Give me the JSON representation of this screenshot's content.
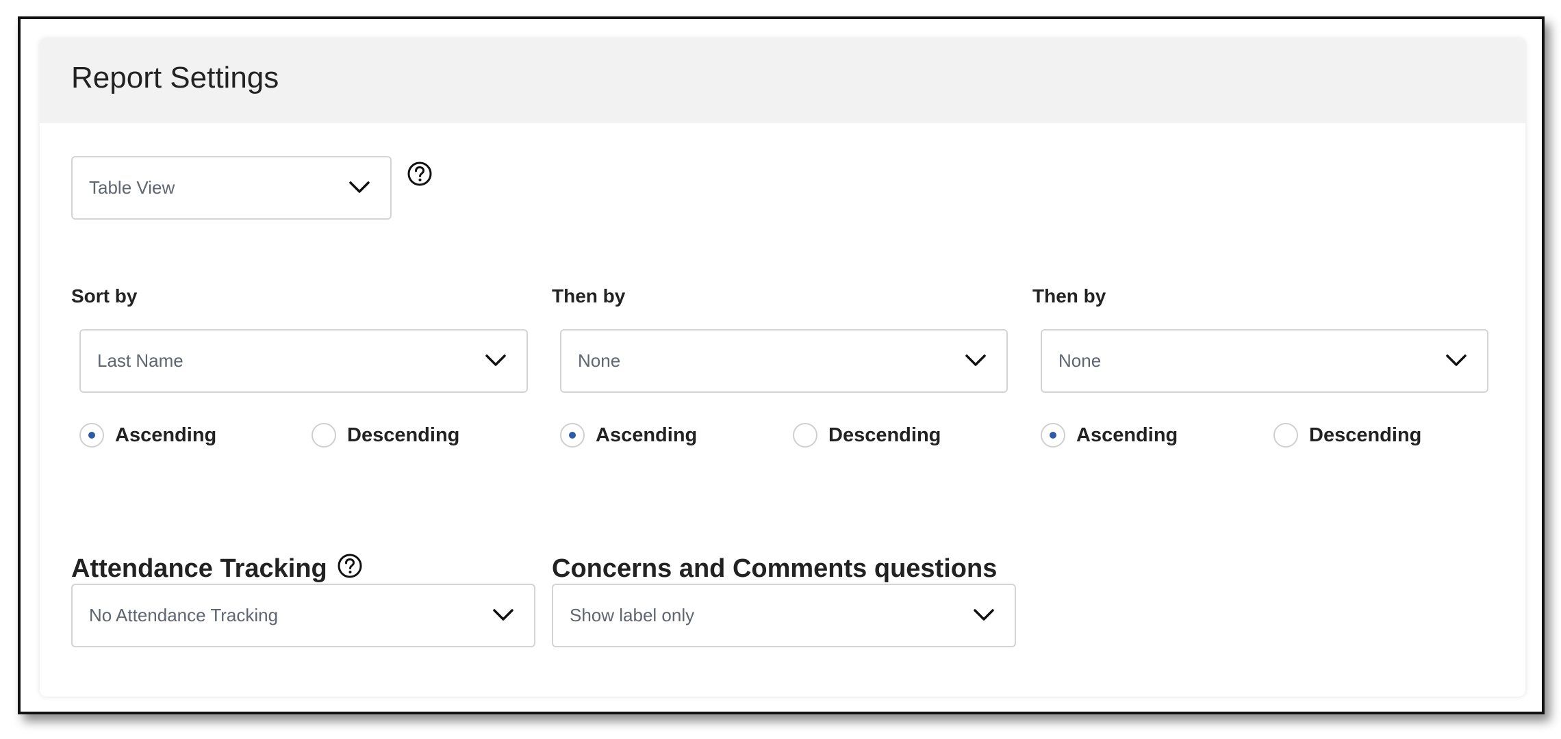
{
  "panel": {
    "title": "Report Settings"
  },
  "view_select": {
    "value": "Table View",
    "help_icon": "question-circle-icon"
  },
  "sort": [
    {
      "label": "Sort by",
      "value": "Last Name",
      "ascending_label": "Ascending",
      "descending_label": "Descending",
      "selected": "ascending"
    },
    {
      "label": "Then by",
      "value": "None",
      "ascending_label": "Ascending",
      "descending_label": "Descending",
      "selected": "ascending"
    },
    {
      "label": "Then by",
      "value": "None",
      "ascending_label": "Ascending",
      "descending_label": "Descending",
      "selected": "ascending"
    }
  ],
  "attendance": {
    "title": "Attendance Tracking",
    "help_icon": "question-circle-icon",
    "value": "No Attendance Tracking"
  },
  "concerns": {
    "title": "Concerns and Comments questions",
    "value": "Show label only"
  },
  "colors": {
    "header_bg": "#f2f2f2",
    "radio_selected": "#2e5aa8",
    "border": "#d4d4d4"
  },
  "icons": {
    "chevron": "chevron-down-icon"
  }
}
